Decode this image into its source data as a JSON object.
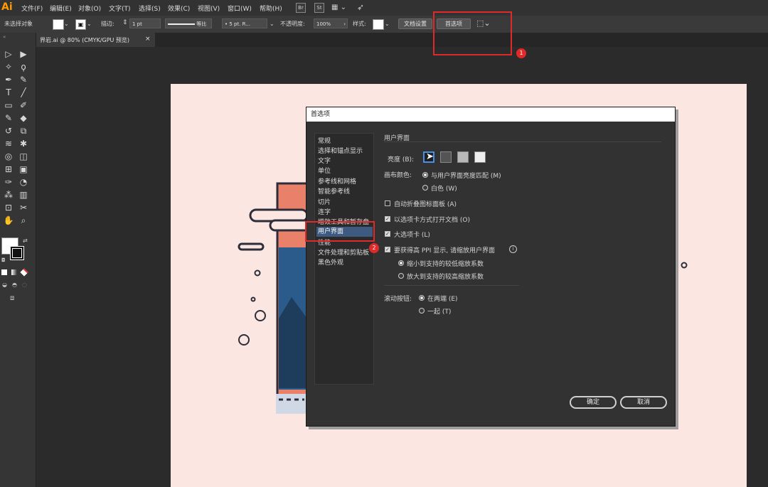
{
  "app": {
    "logo": "Ai",
    "menus": [
      "文件(F)",
      "编辑(E)",
      "对象(O)",
      "文字(T)",
      "选择(S)",
      "效果(C)",
      "视图(V)",
      "窗口(W)",
      "帮助(H)"
    ],
    "bridge_label": "Br",
    "stock_label": "St"
  },
  "control_bar": {
    "selection_status": "未选择对象",
    "stroke_label": "描边:",
    "stroke_weight": "1 pt",
    "stroke_profile": "等比",
    "brush": "5 pt. R...",
    "opacity_label": "不透明度:",
    "opacity_value": "100%",
    "style_label": "样式:",
    "document_setup_button": "文档设置",
    "preferences_button": "首选项"
  },
  "document_tab": {
    "title": "界岩.ai @ 80% (CMYK/GPU 预览)",
    "close": "×"
  },
  "dialog": {
    "title": "首选项",
    "categories": [
      "常规",
      "选择和锚点显示",
      "文字",
      "单位",
      "参考线和网格",
      "智能参考线",
      "切片",
      "连字",
      "增效工具和暂存盘",
      "用户界面",
      "性能",
      "文件处理和剪贴板",
      "黑色外观"
    ],
    "selected_category": "用户界面",
    "section_title": "用户界面",
    "brightness_label": "亮度 (B):",
    "canvas_color_label": "画布颜色:",
    "canvas_options": [
      "与用户界面亮度匹配 (M)",
      "白色 (W)"
    ],
    "auto_collapse_label": "自动折叠图标面板 (A)",
    "open_as_tabs_label": "以选项卡方式打开文档 (O)",
    "large_tabs_label": "大选项卡 (L)",
    "high_ppi_label": "要获得高 PPI 显示, 请缩放用户界面",
    "scale_options": [
      "缩小到支持的较低缩放系数",
      "放大到支持的较高缩放系数"
    ],
    "scroll_label": "滚动按钮:",
    "scroll_options": [
      "在两端 (E)",
      "一起 (T)"
    ],
    "ok_button": "确定",
    "cancel_button": "取消"
  },
  "annotations": {
    "badge_1": "1",
    "badge_2": "2"
  },
  "colors": {
    "accent_red": "#e02a2a",
    "artboard": "#fbe6e1",
    "selection_blue": "#3e5a80"
  }
}
